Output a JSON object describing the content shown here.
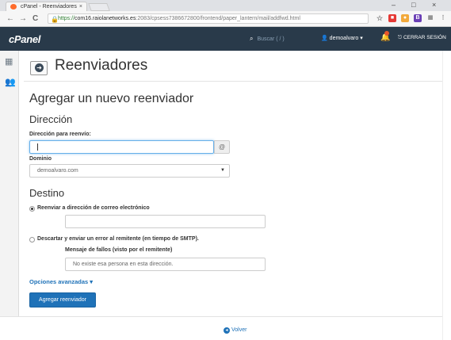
{
  "browser": {
    "tab_title": "cPanel - Reenviadores",
    "tab_close": "×",
    "window_controls": [
      "–",
      "□",
      "×"
    ],
    "nav": {
      "back": "←",
      "forward": "→",
      "reload": "C"
    },
    "url": {
      "scheme": "https://",
      "host": "com16.raiolanetworks.es",
      "path": ":2083/cpsess7386672800/frontend/paper_lantern/mail/addfwd.html"
    },
    "toolbar_icons": [
      "star-icon",
      "extension-red-icon",
      "extension-user-icon",
      "extension-b-icon",
      "extension-grid-icon",
      "menu-icon"
    ]
  },
  "header": {
    "logo": "cPanel",
    "search_placeholder": "Buscar ( / )",
    "user": "demoalvaro",
    "logout": "CERRAR SESIÓN",
    "colors": {
      "header_bg": "#293a4a",
      "accent": "#1f72b8",
      "badge": "#e8572a"
    }
  },
  "page": {
    "title": "Reenviadores",
    "section_title": "Agregar un nuevo reenviador",
    "direccion": {
      "heading": "Dirección",
      "address_label": "Dirección para reenvío:",
      "address_value": "",
      "at_symbol": "@",
      "domain_label": "Dominio",
      "domain_selected": "demoalvaro.com"
    },
    "destino": {
      "heading": "Destino",
      "option_forward": "Reenviar a dirección de correo electrónico",
      "forward_value": "",
      "option_discard": "Descartar y enviar un error al remitente (en tiempo de SMTP).",
      "failure_label": "Mensaje de fallos (visto por el remitente)",
      "failure_placeholder": "No existe esa persona en esta dirección.",
      "selected_option": "forward"
    },
    "advanced_link": "Opciones avanzadas ▾",
    "submit_button": "Agregar reenviador",
    "back_link": "Volver"
  }
}
